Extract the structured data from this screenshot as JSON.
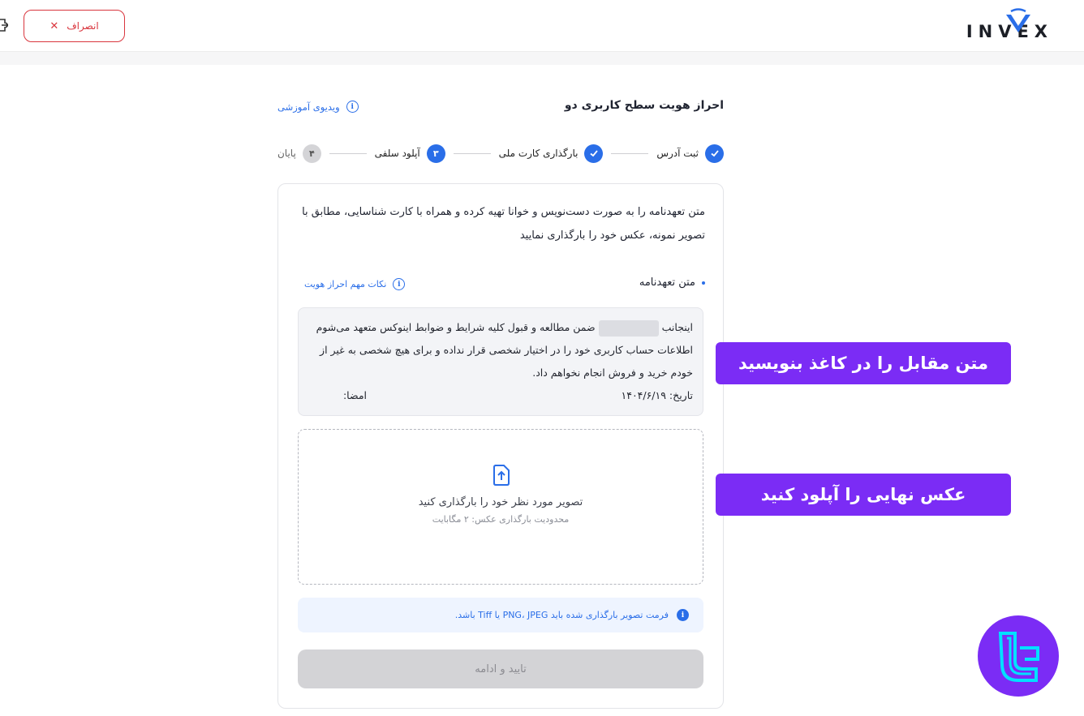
{
  "header": {
    "logo_text": "INVEX",
    "cancel_label": "انصراف"
  },
  "page": {
    "title": "احراز هویت سطح کاربری دو",
    "video_link": "ویدیوی آموزشی"
  },
  "stepper": {
    "steps": [
      {
        "label": "ثبت آدرس",
        "status": "done"
      },
      {
        "label": "بارگذاری کارت ملی",
        "status": "done"
      },
      {
        "label": "آپلود سلفی",
        "number": "۳",
        "status": "active"
      },
      {
        "label": "پایان",
        "number": "۴",
        "status": "pending"
      }
    ]
  },
  "card": {
    "intro": "متن تعهدنامه را به صورت دست‌نویس و خوانا تهیه کرده و همراه با کارت شناسایی، مطابق با تصویر نمونه، عکس خود را بارگذاری نمایید",
    "section_title": "متن تعهدنامه",
    "tips_link": "نکات مهم احراز هویت",
    "pledge_start": "اینجانب",
    "pledge_rest": "ضمن مطالعه و قبول کلیه شرایط و ضوابط اینوکس متعهد می‌شوم اطلاعات حساب کاربری خود را در اختیار شخصی قرار نداده و برای هیچ شخصی به غیر از خودم خرید و فروش انجام نخواهم داد.",
    "pledge_date": "تاریخ: ۱۴۰۴/۶/۱۹",
    "pledge_sign": "امضا:",
    "upload_main": "تصویر مورد نظر خود را بارگذاری کنید",
    "upload_sub": "محدودیت بارگذاری عکس: ۲ مگابایت",
    "format_note": "فرمت تصویر بارگذاری شده باید PNG، JPEG یا Tiff باشد.",
    "submit_label": "تایید و ادامه"
  },
  "callouts": {
    "write_text": "متن مقابل را در کاغذ بنویسید",
    "upload_text": "عکس نهایی را آپلود کنید"
  },
  "colors": {
    "primary": "#2a6ee8",
    "danger": "#d9363e",
    "callout": "#7b2cf5",
    "disabled": "#d3d3d6"
  }
}
